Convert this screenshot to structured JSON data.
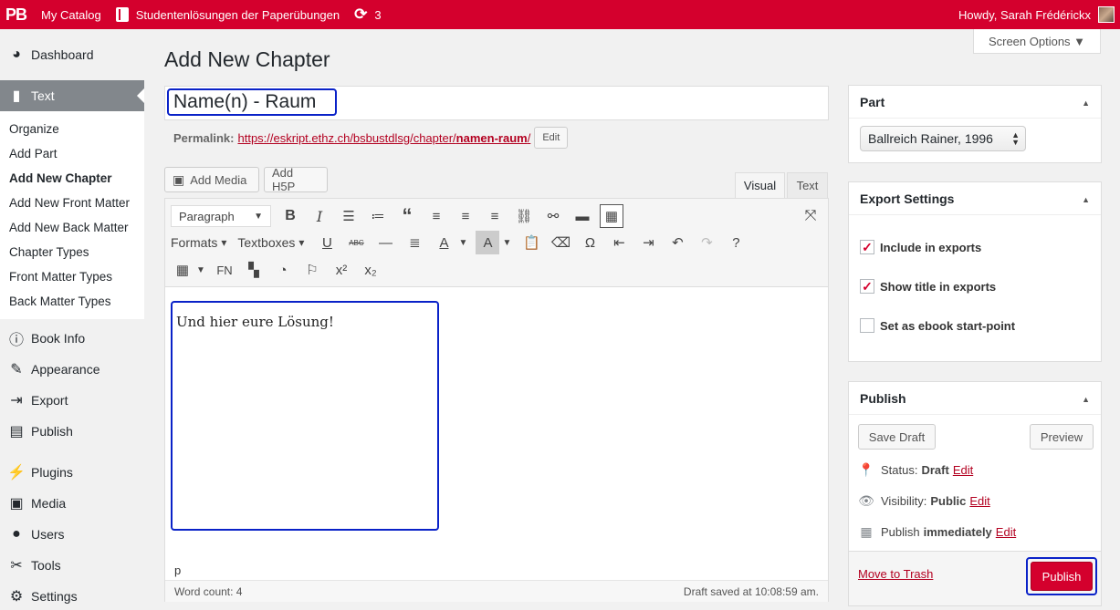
{
  "adminbar": {
    "logo": "PB",
    "catalog": "My Catalog",
    "book": "Studentenlösungen der Paperübungen",
    "updates_icon": "refresh-icon",
    "updates_count": "3",
    "howdy": "Howdy, Sarah Frédérickx"
  },
  "sidebar": {
    "dashboard": "Dashboard",
    "text": "Text",
    "submenu": [
      "Organize",
      "Add Part",
      "Add New Chapter",
      "Add New Front Matter",
      "Add New Back Matter",
      "Chapter Types",
      "Front Matter Types",
      "Back Matter Types"
    ],
    "book_info": "Book Info",
    "appearance": "Appearance",
    "export": "Export",
    "publish": "Publish",
    "plugins": "Plugins",
    "media": "Media",
    "users": "Users",
    "tools": "Tools",
    "settings": "Settings"
  },
  "screen_options": "Screen Options ▼",
  "page_title": "Add New Chapter",
  "title_value": "Name(n) - Raum",
  "permalink": {
    "label": "Permalink:",
    "url_prefix": "https://eskript.ethz.ch/bsbustdlsg/chapter/",
    "slug": "namen-raum",
    "url_suffix": "/",
    "edit": "Edit"
  },
  "editor": {
    "add_media": "Add Media",
    "add_h5p": "Add H5P",
    "tab_visual": "Visual",
    "tab_text": "Text",
    "paragraph": "Paragraph",
    "formats": "Formats",
    "textboxes": "Textboxes",
    "fn": "FN",
    "content": "Und hier eure Lösung!",
    "path": "p",
    "word_count": "Word count: 4",
    "draft_saved": "Draft saved at 10:08:59 am."
  },
  "part_box": {
    "title": "Part",
    "selected": "Ballreich Rainer, 1996"
  },
  "export_box": {
    "title": "Export Settings",
    "include": "Include in exports",
    "show_title": "Show title in exports",
    "ebook_start": "Set as ebook start-point"
  },
  "publish_box": {
    "title": "Publish",
    "save_draft": "Save Draft",
    "preview": "Preview",
    "status_label": "Status:",
    "status_value": "Draft",
    "visibility_label": "Visibility:",
    "visibility_value": "Public",
    "publish_label": "Publish",
    "publish_value": "immediately",
    "edit": "Edit",
    "move_to_trash": "Move to Trash",
    "publish_button": "Publish"
  },
  "colors": {
    "brand": "#d4002d",
    "highlight_outline": "#0a22c8",
    "link": "#b30020"
  }
}
